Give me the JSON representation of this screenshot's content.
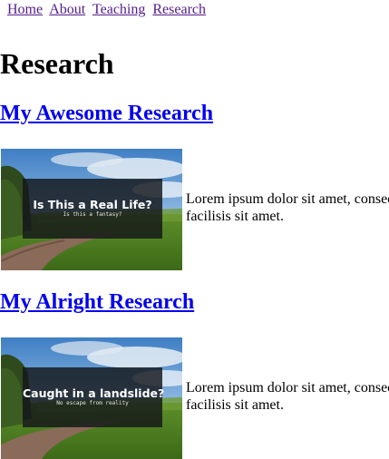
{
  "nav": {
    "links": [
      "Home",
      "About",
      "Teaching",
      "Research"
    ]
  },
  "page": {
    "title": "Research"
  },
  "entries": [
    {
      "title": "My Awesome Research",
      "thumbnail": {
        "caption_title": "Is This a Real Life?",
        "caption_subtitle": "Is this a fantasy?"
      },
      "excerpt_line1": "Lorem ipsum dolor sit amet, consec",
      "excerpt_line2": "facilisis sit amet."
    },
    {
      "title": "My Alright Research",
      "thumbnail": {
        "caption_title": "Caught in a landslide?",
        "caption_subtitle": "No escape from reality"
      },
      "excerpt_line1": "Lorem ipsum dolor sit amet, consec",
      "excerpt_line2": "facilisis sit amet."
    }
  ],
  "colors": {
    "visited_link": "#551a8b",
    "link": "#0000ee"
  }
}
